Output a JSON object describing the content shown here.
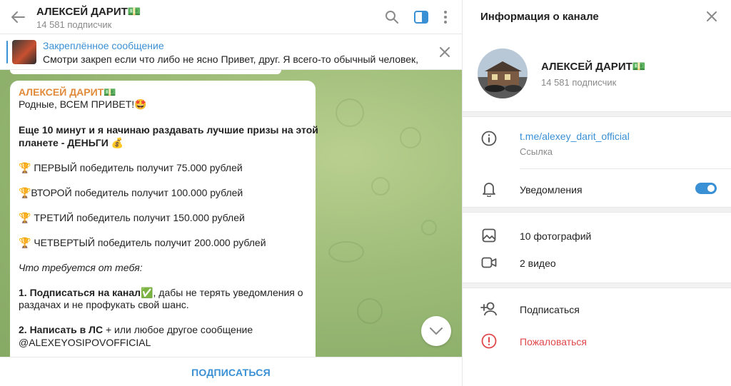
{
  "chat": {
    "title": "АЛЕКСЕЙ ДАРИТ💵",
    "subscribers": "14 581 подписчик",
    "pinned": {
      "title": "Закреплённое сообщение",
      "text": "Смотри закреп если что либо не ясно  Привет, друг. Я всего-то обычный человек, ..."
    },
    "message": {
      "author": "АЛЕКСЕЙ ДАРИТ💵",
      "greeting": "Родные, ВСЕМ ПРИВЕТ!🤩",
      "headline_1": "Еще 10 минут и я начинаю раздавать лучшие призы на этой",
      "headline_2": "планете - ДЕНЬГИ 💰",
      "prize_1": "🏆 ПЕРВЫЙ победитель получит 75.000 рублей",
      "prize_2": "🏆ВТОРОЙ победитель получит 100.000 рублей",
      "prize_3": "🏆 ТРЕТИЙ победитель получит 150.000 рублей",
      "prize_4": "🏆 ЧЕТВЕРТЫЙ победитель получит 200.000 рублей",
      "requirements": "Что требуется от тебя:",
      "step_1_bold": "1. Подписаться на канал✅",
      "step_1_rest": ", дабы не терять уведомления о",
      "step_1_line2": "раздачах и не профукать свой шанс.",
      "step_2_bold": "2. Написать в ЛС",
      "step_2_rest": " + или любое другое сообщение",
      "step_2_link": "@ALEXEYOSIPOVOFFICIAL"
    },
    "subscribe_button": "ПОДПИСАТЬСЯ"
  },
  "info": {
    "title": "Информация о канале",
    "name": "АЛЕКСЕЙ ДАРИТ💵",
    "subscribers": "14 581 подписчик",
    "link": "t.me/alexey_darit_official",
    "link_label": "Ссылка",
    "notifications": "Уведомления",
    "notifications_on": true,
    "photos": "10 фотографий",
    "videos": "2 видео",
    "subscribe": "Подписаться",
    "report": "Пожаловаться"
  },
  "colors": {
    "accent": "#3a90d5",
    "author": "#e08a3a",
    "danger": "#e0484a"
  },
  "icons": [
    "back-arrow-icon",
    "search-icon",
    "sidebar-toggle-icon",
    "more-vertical-icon",
    "close-icon",
    "chevron-down-icon",
    "info-icon",
    "bell-icon",
    "photo-icon",
    "video-icon",
    "add-user-icon",
    "report-icon"
  ]
}
